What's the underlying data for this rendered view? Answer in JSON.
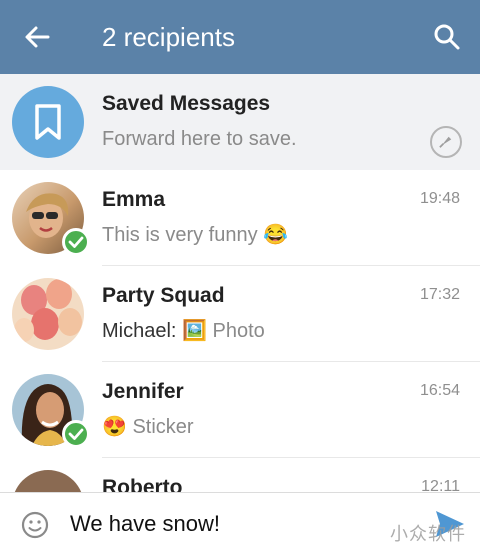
{
  "header": {
    "title": "2 recipients",
    "back_icon": "arrow-left-icon",
    "search_icon": "search-icon"
  },
  "chats": [
    {
      "name": "Saved Messages",
      "preview": "Forward here to save.",
      "time": "",
      "icon": "bookmark-icon"
    },
    {
      "name": "Emma",
      "preview": "This is very funny 😂",
      "time": "19:48",
      "selected": true
    },
    {
      "name": "Party Squad",
      "sender": "Michael: ",
      "preview": "🖼️ Photo",
      "time": "17:32",
      "selected": false
    },
    {
      "name": "Jennifer",
      "preview": "😍 Sticker",
      "time": "16:54",
      "selected": true
    },
    {
      "name": "Roberto",
      "preview": "",
      "time": "12:11",
      "selected": false
    }
  ],
  "composer": {
    "text": "We have snow!",
    "emoji_icon": "smiley-icon",
    "send_icon": "send-icon"
  },
  "watermark": "小众软件",
  "colors": {
    "header": "#5b82a8",
    "accent": "#4caf50",
    "saved_avatar": "#65aadd"
  }
}
